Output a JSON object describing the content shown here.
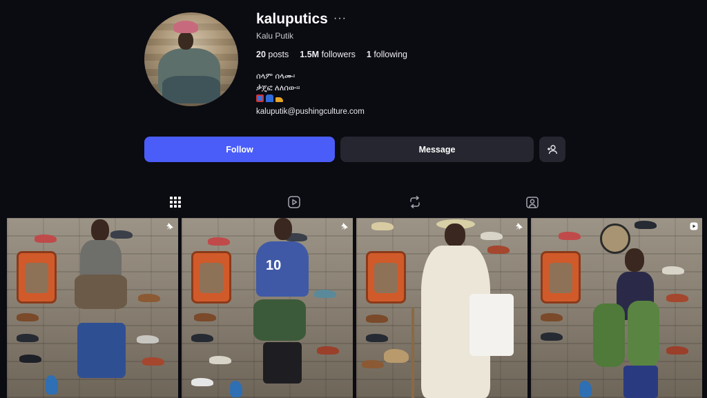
{
  "profile": {
    "username": "kaluputics",
    "more": "···",
    "full_name": "Kalu Putik",
    "stats": {
      "posts_count": "20",
      "posts_label": "posts",
      "followers_count": "1.5M",
      "followers_label": "followers",
      "following_count": "1",
      "following_label": "following"
    },
    "bio": {
      "line1": "ሰላም ሰላሙ፡",
      "line2": "ቃጄፎ ለለሰው፡፡",
      "emojis": [
        "gift-emoji",
        "jeans-emoji",
        "shoe-emoji"
      ],
      "email": "kaluputik@pushingculture.com"
    }
  },
  "actions": {
    "follow_label": "Follow",
    "message_label": "Message",
    "add_user_icon": "add-user-icon"
  },
  "tabs": [
    {
      "name": "posts-grid-icon",
      "selected": true
    },
    {
      "name": "reels-icon",
      "selected": false
    },
    {
      "name": "reposts-icon",
      "selected": false
    },
    {
      "name": "tagged-icon",
      "selected": false
    }
  ],
  "posts": [
    {
      "badge": "pin-icon"
    },
    {
      "badge": "pin-icon"
    },
    {
      "badge": "pin-icon"
    },
    {
      "badge": "reel-icon"
    }
  ],
  "colors": {
    "background": "#0b0b12",
    "follow_button": "#4a5df9",
    "secondary_button": "#25262f"
  }
}
